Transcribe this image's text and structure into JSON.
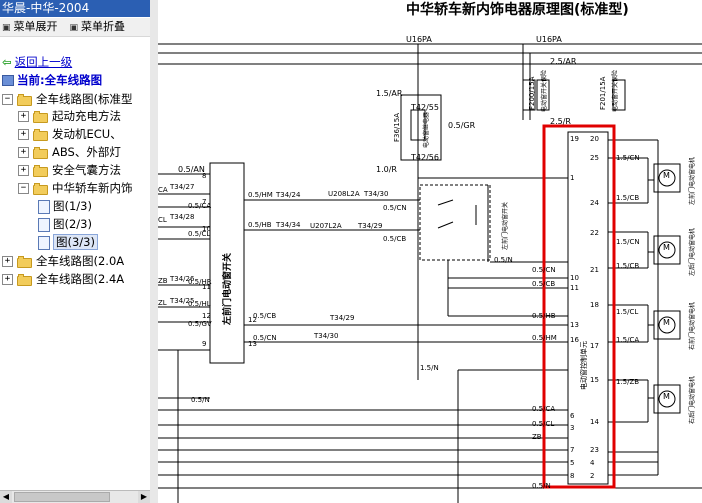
{
  "window": {
    "title": "华晨-中华-2004"
  },
  "menu": {
    "expand": "菜单展开",
    "collapse": "菜单折叠"
  },
  "nav": {
    "back": "返回上一级",
    "current": "当前:全车线路图"
  },
  "tree": {
    "root": "全车线路图(标准型",
    "c1": "起动充电方法",
    "c2": "发动机ECU、",
    "c3": "ABS、外部灯",
    "c4": "安全气囊方法",
    "c5": "中华轿车新内饰",
    "p1": "图(1/3)",
    "p2": "图(2/3)",
    "p3": "图(3/3)",
    "r2": "全车线路图(2.0A",
    "r3": "全车线路图(2.4A"
  },
  "schematic": {
    "title": "中华轿车新内饰电器原理图(标准型)",
    "u1": "U16PA",
    "u2": "U16PA",
    "f36": "F36/15A",
    "f200": "F200/15A",
    "f201": "F201/15A",
    "relay_label": "电动窗继电器",
    "fuse_label": "电动窗开关保险",
    "fuse_label2": "电动窗开关保险",
    "t42_55": "T42/55",
    "t42_56": "T42/56",
    "w15ar": "1.5/AR",
    "w05gr": "0.5/GR",
    "w10r": "1.0/R",
    "w25ar": "2.5/AR",
    "w25r": "2.5/R",
    "w05an": "0.5/AN",
    "lsw": "左前门电动窗开关",
    "rsw": "左前门电动窗开关",
    "ctrl": "电动窗控制单元",
    "m1": "左前门电动窗电机",
    "m2": "左后门电动窗电机",
    "m3": "右前门电动窗电机",
    "m4": "右后门电动窗电机",
    "wires": {
      "hm": "0.5/HM",
      "hb": "0.5/HB",
      "ca": "0.5/CA",
      "cl": "0.5/CL",
      "cn": "0.5/CN",
      "cb": "0.5/CB",
      "hr": "0.5/HR",
      "hl": "0.5/HL",
      "gv": "0.5/GV",
      "n": "0.5/N",
      "n15": "1.5/N",
      "n05": "0.5/N",
      "ca_short": "CA",
      "cl_short": "CL",
      "zb": "ZB",
      "zl": "ZL",
      "cn15": "1.5/CN",
      "cb15": "1.5/CB",
      "cl15": "1.5/CL",
      "ca15": "1.5/CA",
      "zb15": "1.5/ZB"
    },
    "conns": {
      "t34_24": "T34/24",
      "t34_34": "T34/34",
      "t34_30": "T34/30",
      "t34_29": "T34/29",
      "t34_27": "T34/27",
      "t34_28": "T34/28",
      "t34_26": "T34/26",
      "t34_25": "T34/25",
      "t34_29b": "T34/29",
      "t34_30b": "T34/30",
      "u208": "U208L2A",
      "u207": "U207L2A"
    },
    "m": "M",
    "pins": [
      "8",
      "7",
      "10",
      "11",
      "12",
      "13",
      "9",
      "6",
      "5",
      "4",
      "3",
      "2",
      "1",
      "19",
      "20",
      "25",
      "24",
      "22",
      "23",
      "21",
      "18",
      "17",
      "15",
      "14"
    ]
  }
}
